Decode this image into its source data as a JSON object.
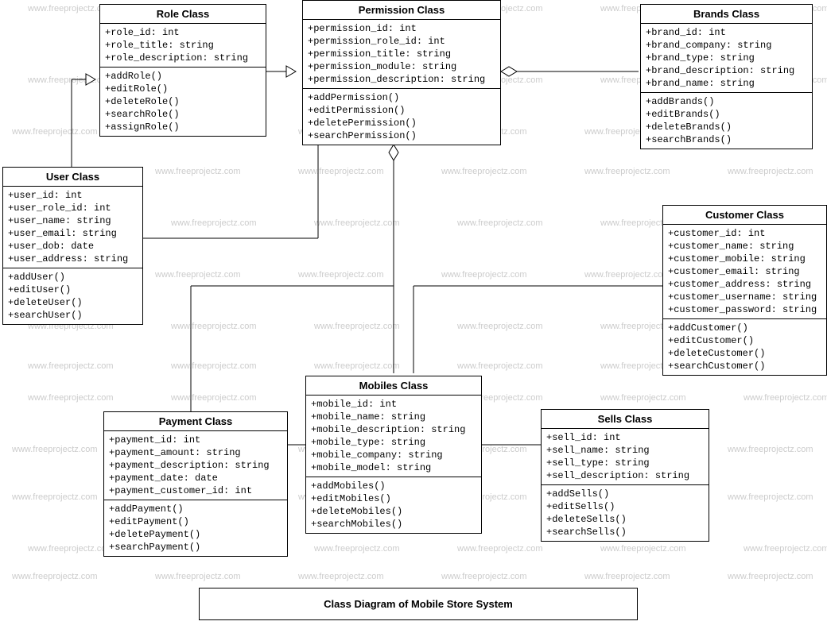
{
  "watermark_text": "www.freeprojectz.com",
  "caption": "Class Diagram of Mobile Store System",
  "classes": {
    "role": {
      "title": "Role Class",
      "attrs": [
        "+role_id: int",
        "+role_title: string",
        "+role_description: string"
      ],
      "ops": [
        "+addRole()",
        "+editRole()",
        "+deleteRole()",
        "+searchRole()",
        "+assignRole()"
      ]
    },
    "permission": {
      "title": "Permission Class",
      "attrs": [
        "+permission_id: int",
        "+permission_role_id: int",
        "+permission_title: string",
        "+permission_module: string",
        "+permission_description: string"
      ],
      "ops": [
        "+addPermission()",
        "+editPermission()",
        "+deletePermission()",
        "+searchPermission()"
      ]
    },
    "brands": {
      "title": "Brands Class",
      "attrs": [
        "+brand_id: int",
        "+brand_company: string",
        "+brand_type: string",
        "+brand_description: string",
        "+brand_name: string"
      ],
      "ops": [
        "+addBrands()",
        "+editBrands()",
        "+deleteBrands()",
        "+searchBrands()"
      ]
    },
    "user": {
      "title": "User Class",
      "attrs": [
        "+user_id: int",
        "+user_role_id: int",
        "+user_name: string",
        "+user_email: string",
        "+user_dob: date",
        "+user_address: string"
      ],
      "ops": [
        "+addUser()",
        "+editUser()",
        "+deleteUser()",
        "+searchUser()"
      ]
    },
    "customer": {
      "title": "Customer Class",
      "attrs": [
        "+customer_id: int",
        "+customer_name: string",
        "+customer_mobile: string",
        "+customer_email: string",
        "+customer_address: string",
        "+customer_username: string",
        "+customer_password: string"
      ],
      "ops": [
        "+addCustomer()",
        "+editCustomer()",
        "+deleteCustomer()",
        "+searchCustomer()"
      ]
    },
    "payment": {
      "title": "Payment Class",
      "attrs": [
        "+payment_id: int",
        "+payment_amount: string",
        "+payment_description: string",
        "+payment_date: date",
        "+payment_customer_id: int"
      ],
      "ops": [
        "+addPayment()",
        "+editPayment()",
        "+deletePayment()",
        "+searchPayment()"
      ]
    },
    "mobiles": {
      "title": "Mobiles  Class",
      "attrs": [
        "+mobile_id: int",
        "+mobile_name: string",
        "+mobile_description: string",
        "+mobile_type: string",
        "+mobile_company: string",
        "+mobile_model: string"
      ],
      "ops": [
        "+addMobiles()",
        "+editMobiles()",
        "+deleteMobiles()",
        "+searchMobiles()"
      ]
    },
    "sells": {
      "title": "Sells Class",
      "attrs": [
        "+sell_id: int",
        "+sell_name: string",
        "+sell_type: string",
        "+sell_description: string"
      ],
      "ops": [
        "+addSells()",
        "+editSells()",
        "+deleteSells()",
        "+searchSells()"
      ]
    }
  }
}
